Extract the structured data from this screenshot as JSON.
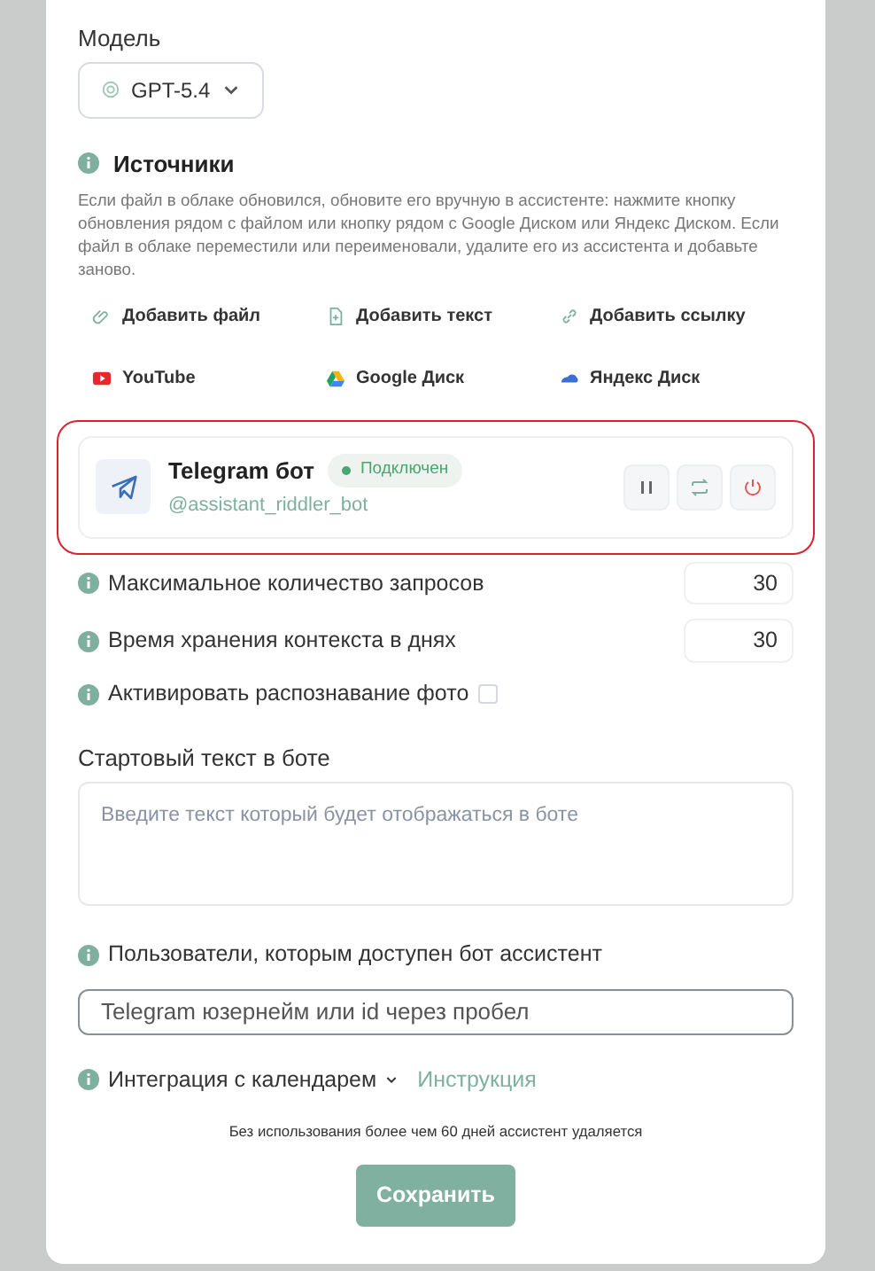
{
  "model": {
    "label": "Модель",
    "value": "GPT-5.4"
  },
  "sources": {
    "title": "Источники",
    "description": "Если файл в облаке обновился, обновите его вручную в ассистенте: нажмите кнопку обновления рядом с файлом или кнопку рядом с Google Диском или Яндекс Диском. Если файл в облаке переместили или переименовали, удалите его из ассистента и добавьте заново.",
    "actions": [
      {
        "label": "Добавить файл",
        "kind": "file"
      },
      {
        "label": "Добавить текст",
        "kind": "text"
      },
      {
        "label": "Добавить ссылку",
        "kind": "link"
      },
      {
        "label": "YouTube",
        "kind": "youtube"
      },
      {
        "label": "Google Диск",
        "kind": "gdrive"
      },
      {
        "label": "Яндекс Диск",
        "kind": "ydisk"
      }
    ]
  },
  "telegram": {
    "title": "Telegram бот",
    "status": "Подключен",
    "connected": true,
    "handle": "@assistant_riddler_bot",
    "highlighted": true,
    "controls": [
      {
        "kind": "pause"
      },
      {
        "kind": "refresh"
      },
      {
        "kind": "power"
      }
    ]
  },
  "settings": [
    {
      "kind": "number",
      "label": "Максимальное количество запросов",
      "value": "30"
    },
    {
      "kind": "number",
      "label": "Время хранения контекста в днях",
      "value": "30"
    },
    {
      "kind": "checkbox",
      "label": "Активировать распознавание фото",
      "checked": false
    }
  ],
  "start_text": {
    "label": "Стартовый текст в боте",
    "placeholder": "Введите текст который будет отображаться в боте"
  },
  "users": {
    "label": "Пользователи, которым доступен бот ассистент",
    "placeholder": "Telegram юзернейм или id через пробел"
  },
  "calendar": {
    "label": "Интеграция с календарем",
    "expanded": false,
    "link": "Инструкция"
  },
  "note": "Без использования более чем 60 дней ассистент удаляется",
  "save_button": "Сохранить"
}
